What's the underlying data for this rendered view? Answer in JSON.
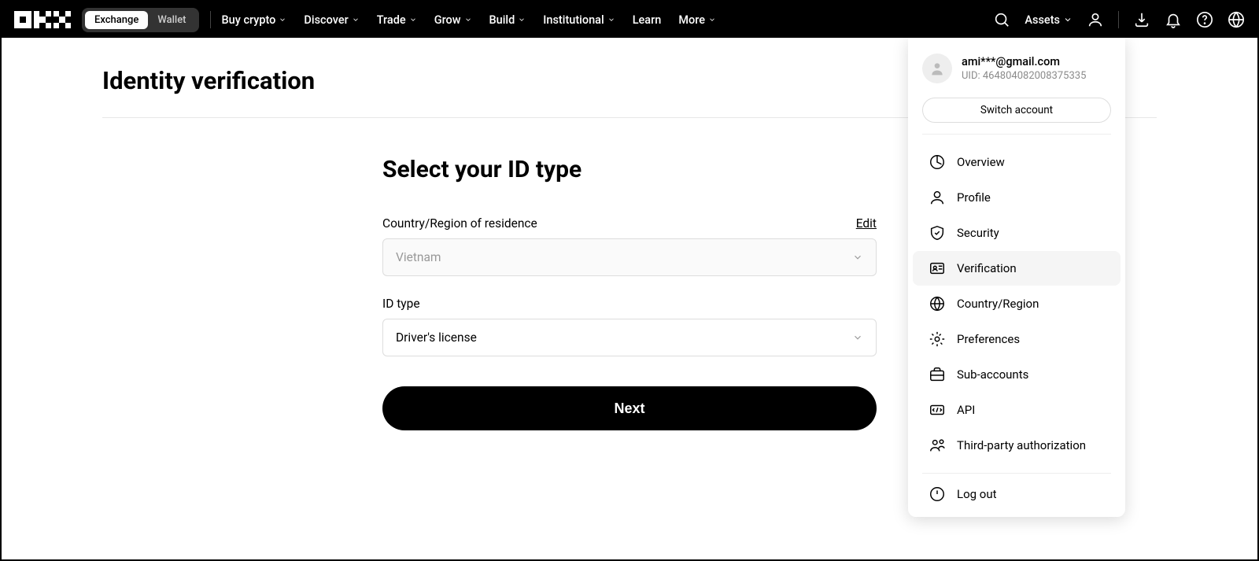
{
  "header": {
    "mode_exchange": "Exchange",
    "mode_wallet": "Wallet",
    "nav": [
      "Buy crypto",
      "Discover",
      "Trade",
      "Grow",
      "Build",
      "Institutional",
      "Learn",
      "More"
    ],
    "nav_has_chevron": [
      true,
      true,
      true,
      true,
      true,
      true,
      false,
      true
    ],
    "assets_label": "Assets"
  },
  "page": {
    "title": "Identity verification",
    "form_title": "Select your ID type",
    "country_label": "Country/Region of residence",
    "edit_label": "Edit",
    "country_value": "Vietnam",
    "idtype_label": "ID type",
    "idtype_value": "Driver's license",
    "next_label": "Next"
  },
  "account_menu": {
    "email": "ami***@gmail.com",
    "uid_label": "UID: 464804082008375335",
    "switch_label": "Switch account",
    "items": [
      {
        "key": "overview",
        "label": "Overview"
      },
      {
        "key": "profile",
        "label": "Profile"
      },
      {
        "key": "security",
        "label": "Security"
      },
      {
        "key": "verification",
        "label": "Verification"
      },
      {
        "key": "country",
        "label": "Country/Region"
      },
      {
        "key": "preferences",
        "label": "Preferences"
      },
      {
        "key": "subaccounts",
        "label": "Sub-accounts"
      },
      {
        "key": "api",
        "label": "API"
      },
      {
        "key": "thirdparty",
        "label": "Third-party authorization"
      }
    ],
    "logout_label": "Log out"
  }
}
